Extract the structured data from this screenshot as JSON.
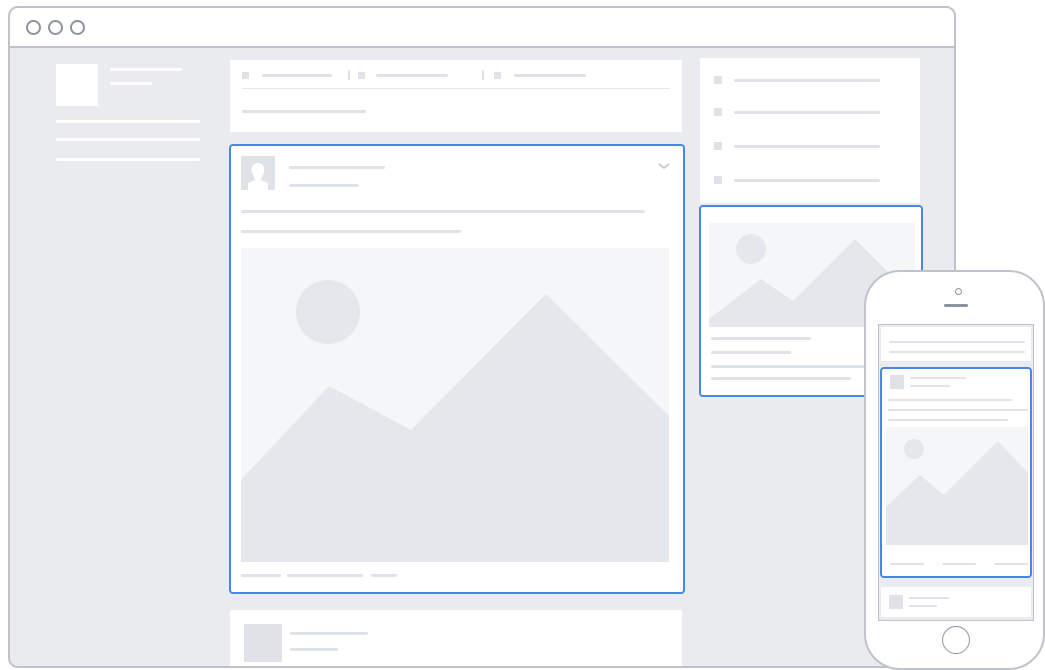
{
  "window": {
    "controls": [
      "window-control-1",
      "window-control-2",
      "window-control-3"
    ]
  },
  "colors": {
    "frame": "#bfc3c9",
    "background": "#e9ebee",
    "placeholder": "#dfe2e6",
    "image_placeholder": "#f5f6f7",
    "shape": "#e4e7eb",
    "highlight": "#4a86e8"
  },
  "icons": {
    "avatar": "person-silhouette-icon",
    "image": "landscape-image-icon",
    "menu": "chevron-down-icon",
    "phone_camera": "camera-dot-icon",
    "phone_home": "home-button-icon"
  }
}
